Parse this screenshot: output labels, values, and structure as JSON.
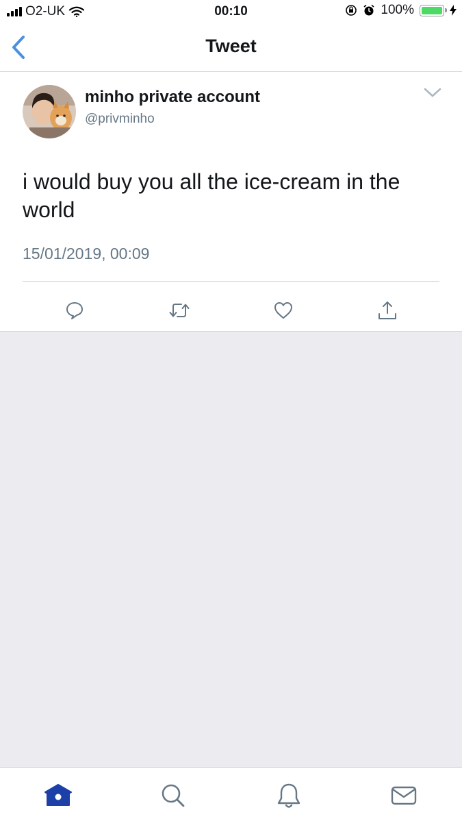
{
  "status_bar": {
    "carrier": "O2-UK",
    "time": "00:10",
    "battery": "100%",
    "battery_level": 1.0,
    "battery_color": "#4cd964"
  },
  "nav": {
    "title": "Tweet",
    "back_icon": "chevron-left-icon",
    "accent": "#4a90e2"
  },
  "tweet": {
    "author_name": "minho private account",
    "author_handle": "@privminho",
    "text": "i would buy you all the ice-cream in the world",
    "timestamp": "15/01/2019, 00:09"
  },
  "actions": [
    {
      "icon": "reply-icon"
    },
    {
      "icon": "retweet-icon"
    },
    {
      "icon": "like-icon"
    },
    {
      "icon": "share-icon"
    }
  ],
  "tabs": [
    {
      "icon": "home-icon",
      "active": true,
      "color": "#1d3fa8"
    },
    {
      "icon": "search-icon",
      "active": false
    },
    {
      "icon": "notifications-icon",
      "active": false
    },
    {
      "icon": "messages-icon",
      "active": false
    }
  ]
}
